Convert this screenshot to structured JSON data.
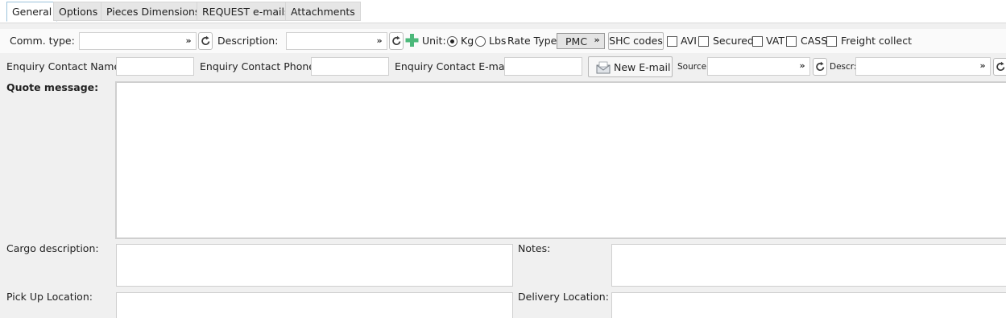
{
  "tabs": [
    {
      "label": "General",
      "active": true
    },
    {
      "label": "Options",
      "active": false
    },
    {
      "label": "Pieces Dimensions",
      "active": false
    },
    {
      "label": "REQUEST e-mails",
      "active": false
    },
    {
      "label": "Attachments",
      "active": false
    }
  ],
  "row1": {
    "comm_type_label": "Comm. type:",
    "comm_type_value": "",
    "description_label": "Description:",
    "description_value": "",
    "unit_label": "Unit:",
    "unit_kg": "Kg",
    "unit_lbs": "Lbs",
    "unit_selected": "Kg",
    "rate_type_label": "Rate Type:",
    "rate_type_value": "PMC",
    "shc_codes_button": "SHC codes",
    "avi_label": "AVI",
    "secured_label": "Secured",
    "vat_label": "VAT",
    "cass_label": "CASS",
    "freight_collect_label": "Freight collect"
  },
  "row2": {
    "contact_name_label": "Enquiry Contact Name:",
    "contact_name_value": "",
    "contact_phone_label": "Enquiry Contact Phone:",
    "contact_phone_value": "",
    "contact_email_label": "Enquiry Contact E-mail:",
    "contact_email_value": "",
    "new_email_button": "New E-mail",
    "source_label": "Source:",
    "source_value": "",
    "descr_label": "Descr:",
    "descr_value": ""
  },
  "quote": {
    "label": "Quote message:",
    "value": ""
  },
  "cargo": {
    "label": "Cargo description:",
    "value": ""
  },
  "notes": {
    "label": "Notes:",
    "value": ""
  },
  "pickup": {
    "label": "Pick Up Location:",
    "value": ""
  },
  "delivery": {
    "label": "Delivery Location:",
    "value": ""
  },
  "icons": {
    "refresh": "refresh-icon",
    "plus": "plus-icon",
    "chevron": "double-chevron-down-icon",
    "email": "envelope-icon"
  },
  "colors": {
    "active_tab_border": "#9cc3dc",
    "plus_green": "#4cb87a"
  }
}
